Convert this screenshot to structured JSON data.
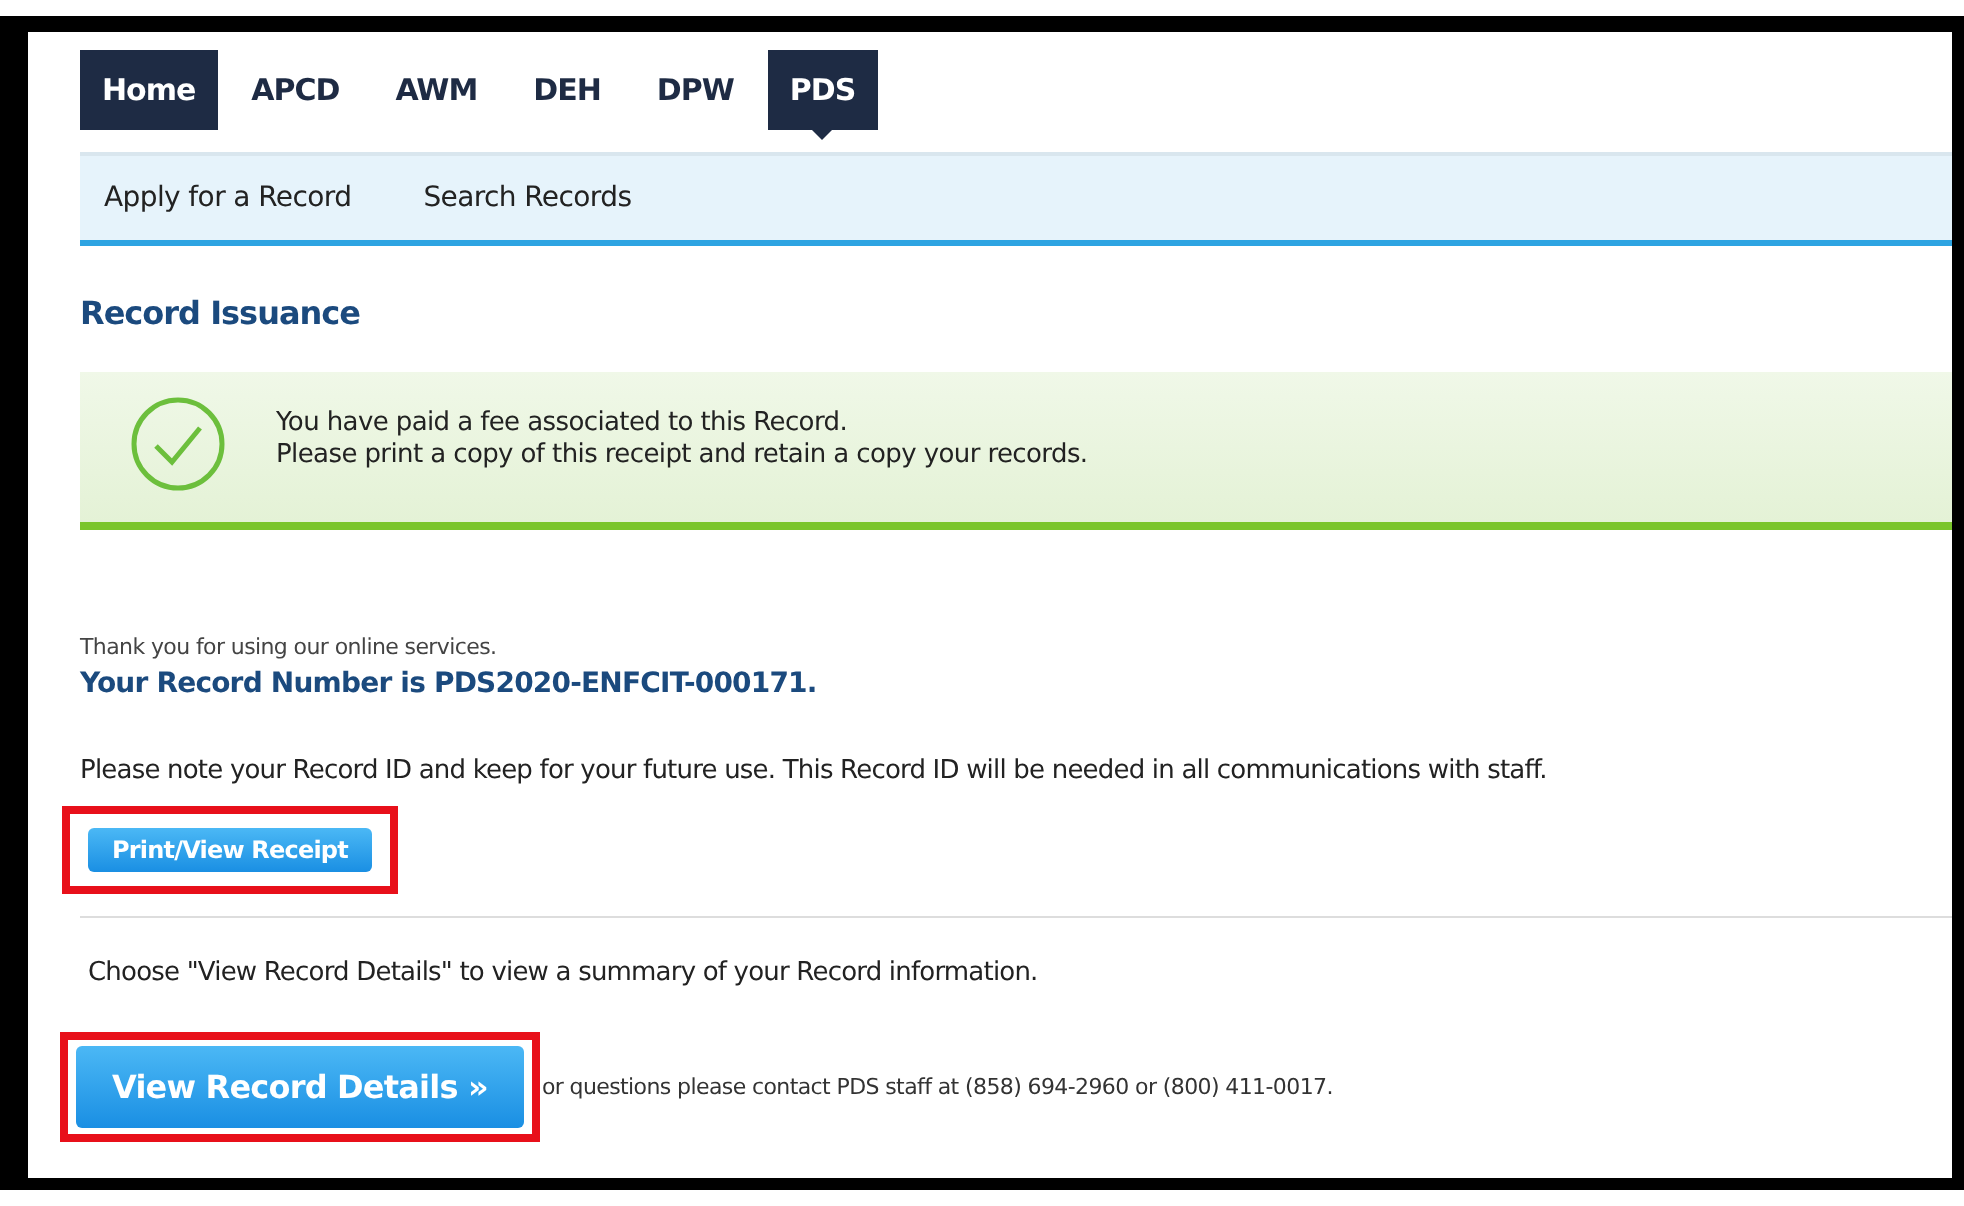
{
  "tabs": [
    {
      "label": "Home",
      "highlighted": true,
      "selected": false
    },
    {
      "label": "APCD",
      "highlighted": false,
      "selected": false
    },
    {
      "label": "AWM",
      "highlighted": false,
      "selected": false
    },
    {
      "label": "DEH",
      "highlighted": false,
      "selected": false
    },
    {
      "label": "DPW",
      "highlighted": false,
      "selected": false
    },
    {
      "label": "PDS",
      "highlighted": true,
      "selected": true
    }
  ],
  "subnav": [
    "Apply for a Record",
    "Search Records"
  ],
  "title": "Record Issuance",
  "notice": {
    "lines": [
      "You have paid a fee associated to this Record.",
      "Please print a copy of this receipt and retain a copy your records."
    ]
  },
  "thanks": "Thank you for using our online services.",
  "record_number": "Your Record Number is PDS2020-ENFCIT-000171.",
  "note": "Please note your Record ID and keep for your future use. This Record ID will be needed in all communications with staff.",
  "receipt_button": {
    "label": "Print/View Receipt",
    "annotated": true
  },
  "choose_text": "Choose \"View Record Details\" to view a summary of your Record information.",
  "details_button": {
    "label": "View Record Details »",
    "annotated": true
  },
  "contact_text": "or questions please contact PDS staff at (858) 694-2960 or (800) 411-0017."
}
